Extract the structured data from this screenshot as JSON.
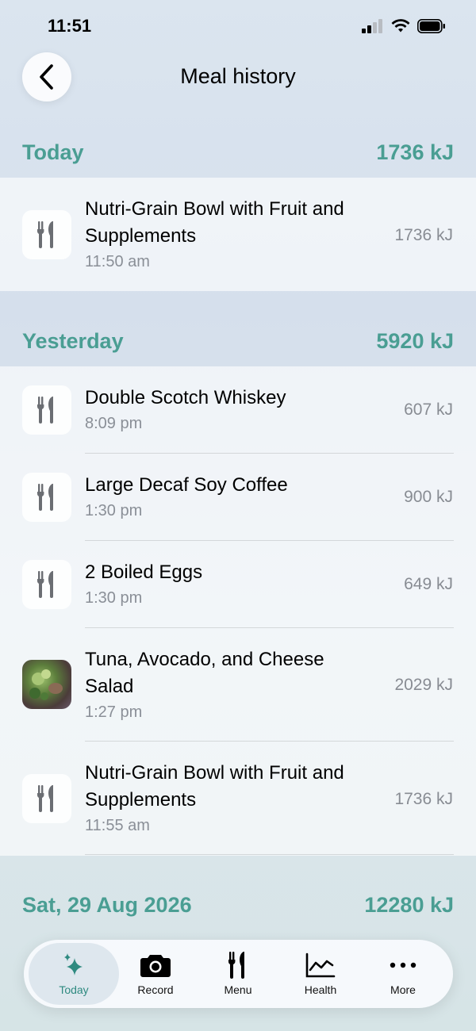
{
  "status": {
    "time": "11:51"
  },
  "header": {
    "title": "Meal history"
  },
  "sections": [
    {
      "label": "Today",
      "total": "1736 kJ",
      "meals": [
        {
          "name": "Nutri-Grain Bowl with Fruit and Supplements",
          "time": "11:50 am",
          "kj": "1736 kJ",
          "icon": "fork-knife-icon"
        }
      ]
    },
    {
      "label": "Yesterday",
      "total": "5920 kJ",
      "meals": [
        {
          "name": "Double Scotch Whiskey",
          "time": "8:09 pm",
          "kj": "607 kJ",
          "icon": "fork-knife-icon"
        },
        {
          "name": "Large Decaf Soy Coffee",
          "time": "1:30 pm",
          "kj": "900 kJ",
          "icon": "fork-knife-icon"
        },
        {
          "name": "2 Boiled Eggs",
          "time": "1:30 pm",
          "kj": "649 kJ",
          "icon": "fork-knife-icon"
        },
        {
          "name": "Tuna, Avocado, and Cheese Salad",
          "time": "1:27 pm",
          "kj": "2029 kJ",
          "icon": "meal-photo"
        },
        {
          "name": "Nutri-Grain Bowl with Fruit and Supplements",
          "time": "11:55 am",
          "kj": "1736 kJ",
          "icon": "fork-knife-icon"
        }
      ]
    },
    {
      "label": "Sat, 29 Aug 2026",
      "total": "12280 kJ",
      "meals": []
    }
  ],
  "tabs": [
    {
      "label": "Today",
      "icon": "sparkle-icon",
      "active": true
    },
    {
      "label": "Record",
      "icon": "camera-icon",
      "active": false
    },
    {
      "label": "Menu",
      "icon": "fork-knife-icon",
      "active": false
    },
    {
      "label": "Health",
      "icon": "chart-icon",
      "active": false
    },
    {
      "label": "More",
      "icon": "more-icon",
      "active": false
    }
  ],
  "colors": {
    "accent": "#4a9e93",
    "active_tab": "#2e8a80"
  }
}
